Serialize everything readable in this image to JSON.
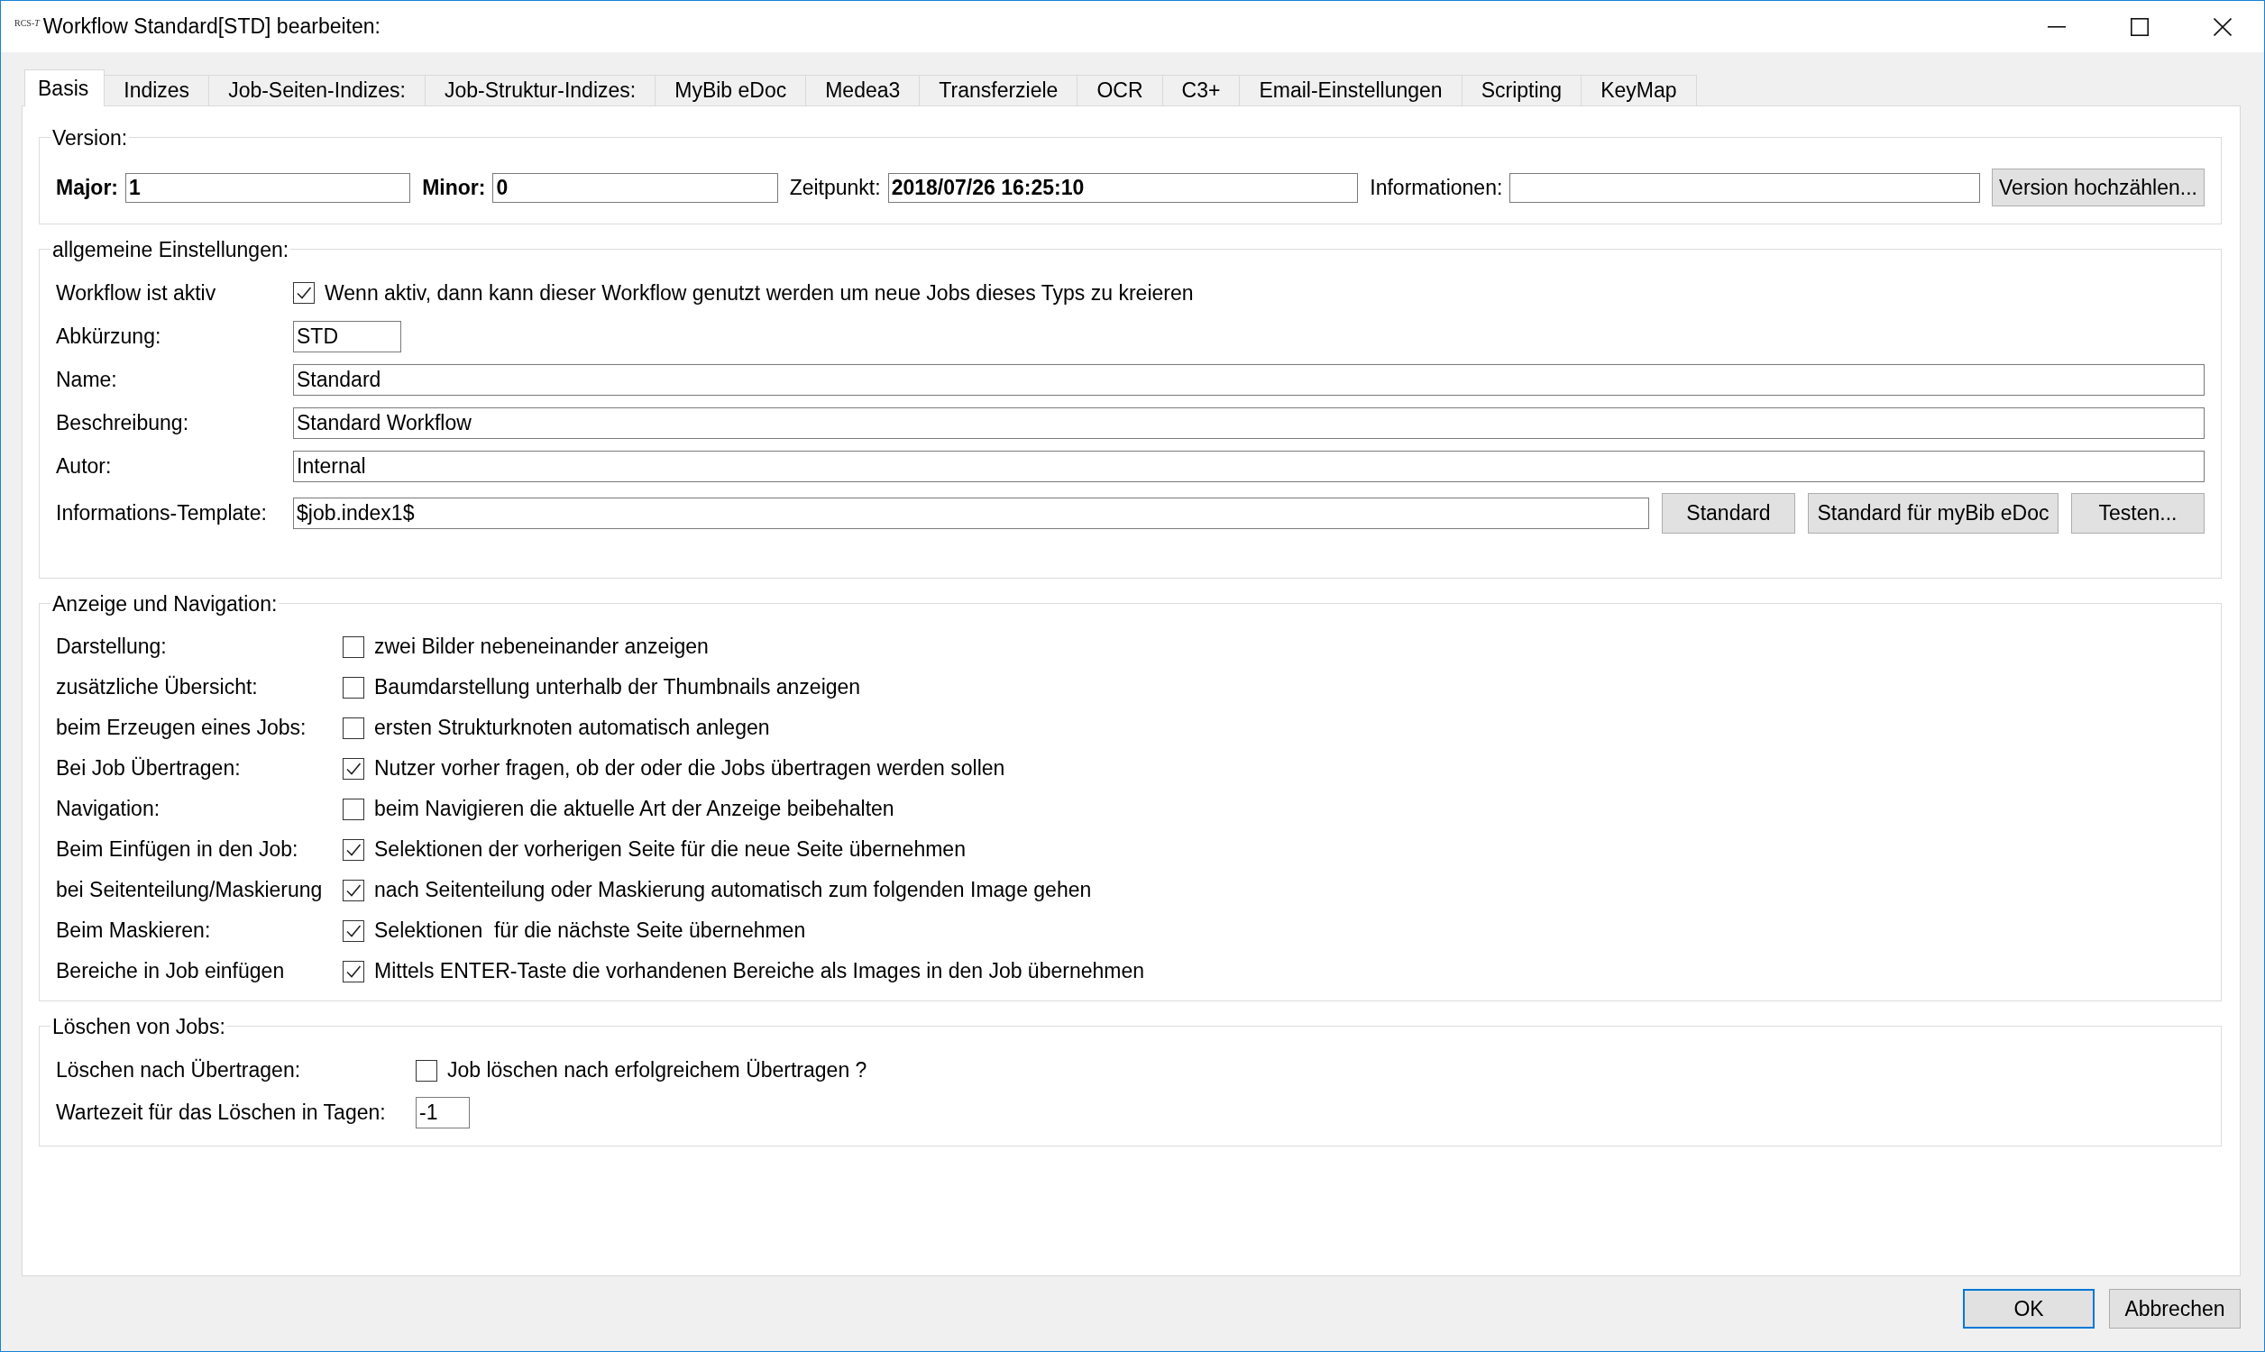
{
  "window": {
    "app_logo": "RCS-*T*",
    "title": "Workflow Standard[STD] bearbeiten:"
  },
  "tabs": [
    {
      "label": "Basis",
      "selected": true
    },
    {
      "label": "Indizes",
      "selected": false
    },
    {
      "label": "Job-Seiten-Indizes:",
      "selected": false
    },
    {
      "label": "Job-Struktur-Indizes:",
      "selected": false
    },
    {
      "label": "MyBib eDoc",
      "selected": false
    },
    {
      "label": "Medea3",
      "selected": false
    },
    {
      "label": "Transferziele",
      "selected": false
    },
    {
      "label": "OCR",
      "selected": false
    },
    {
      "label": "C3+",
      "selected": false
    },
    {
      "label": "Email-Einstellungen",
      "selected": false
    },
    {
      "label": "Scripting",
      "selected": false
    },
    {
      "label": "KeyMap",
      "selected": false
    }
  ],
  "version": {
    "title": "Version:",
    "fields": [
      {
        "label": "Major:",
        "bold_label": true,
        "value": "1"
      },
      {
        "label": "Minor:",
        "bold_label": true,
        "value": "0"
      },
      {
        "label": "Zeitpunkt:",
        "bold_label": false,
        "value": "2018/07/26 16:25:10"
      },
      {
        "label": "Informationen:",
        "bold_label": false
      }
    ],
    "button": "Version hochzählen..."
  },
  "general": {
    "title": "allgemeine Einstellungen:",
    "rows": [
      {
        "kind": "checkbox",
        "label": "Workflow ist aktiv",
        "checked": true,
        "text": "Wenn aktiv, dann kann dieser Workflow genutzt werden um neue Jobs dieses Typs zu kreieren"
      },
      {
        "kind": "short_field",
        "label": "Abkürzung:",
        "value": "STD"
      },
      {
        "kind": "field",
        "label": "Name:",
        "value": "Standard"
      },
      {
        "kind": "field",
        "label": "Beschreibung:",
        "value": "Standard Workflow"
      },
      {
        "kind": "field",
        "label": "Autor:",
        "value": "Internal"
      },
      {
        "kind": "field_buttons",
        "label": "Informations-Template:",
        "value": "$job.index1$",
        "buttons": [
          "Standard",
          "Standard für myBib eDoc",
          "Testen..."
        ]
      }
    ]
  },
  "display": {
    "title": "Anzeige und Navigation:",
    "rows": [
      {
        "label": "Darstellung:",
        "checked": false,
        "text": "zwei Bilder nebeneinander anzeigen"
      },
      {
        "label": "zusätzliche Übersicht:",
        "checked": false,
        "text": "Baumdarstellung unterhalb der Thumbnails anzeigen"
      },
      {
        "label": "beim Erzeugen eines Jobs:",
        "checked": false,
        "text": "ersten Strukturknoten automatisch anlegen"
      },
      {
        "label": "Bei Job Übertragen:",
        "checked": true,
        "text": "Nutzer vorher fragen, ob der oder die Jobs übertragen werden sollen"
      },
      {
        "label": "Navigation:",
        "checked": false,
        "text": "beim Navigieren die aktuelle Art der Anzeige beibehalten"
      },
      {
        "label": "Beim Einfügen in den Job:",
        "checked": true,
        "text": "Selektionen der vorherigen Seite für die neue Seite übernehmen"
      },
      {
        "label": "bei Seitenteilung/Maskierung",
        "checked": true,
        "text": "nach Seitenteilung oder Maskierung automatisch zum folgenden Image gehen"
      },
      {
        "label": "Beim Maskieren:",
        "checked": true,
        "text": "Selektionen  für die nächste Seite übernehmen"
      },
      {
        "label": "Bereiche in Job einfügen",
        "checked": true,
        "text": "Mittels ENTER-Taste die vorhandenen Bereiche als Images in den Job übernehmen"
      }
    ]
  },
  "deletion": {
    "title": "Löschen von Jobs:",
    "rows": [
      {
        "kind": "checkbox",
        "label": "Löschen nach Übertragen:",
        "checked": false,
        "text": "Job löschen nach erfolgreichem Übertragen ?"
      },
      {
        "kind": "short_field",
        "label": "Wartezeit für das Löschen in Tagen:",
        "value": "-1"
      }
    ]
  },
  "buttons": [
    {
      "label": "OK",
      "default": true
    },
    {
      "label": "Abbrechen",
      "default": false
    }
  ]
}
